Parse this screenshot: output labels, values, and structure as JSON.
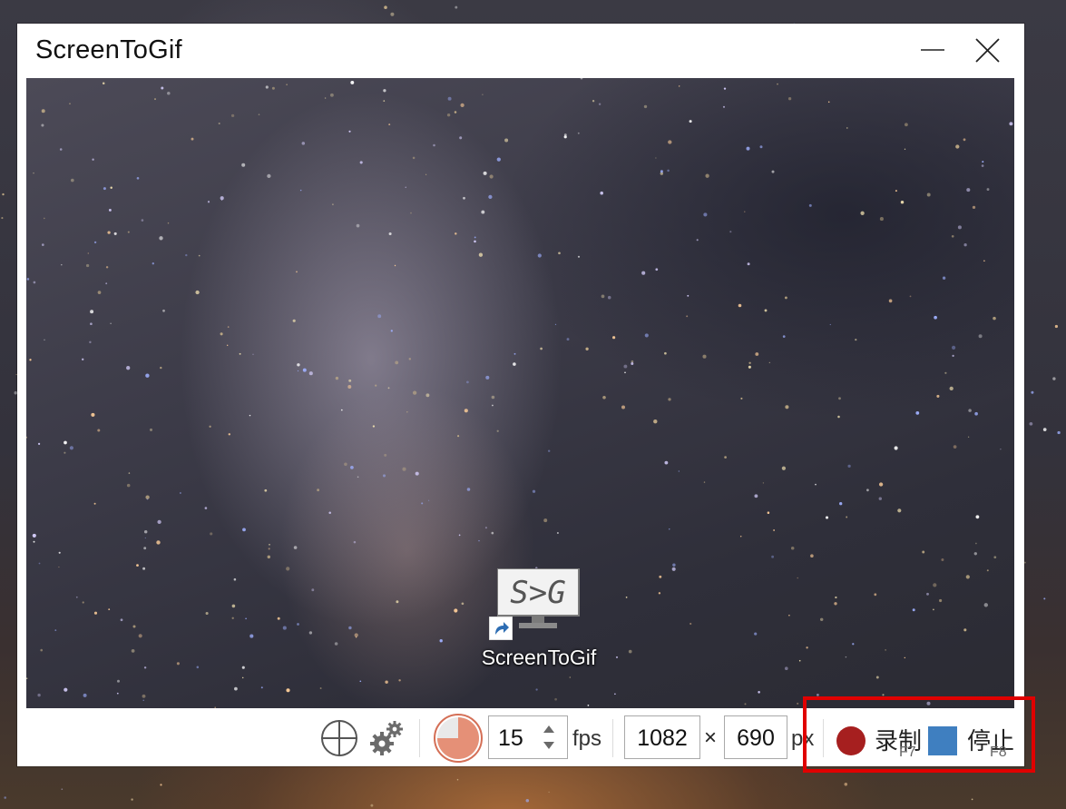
{
  "window": {
    "title": "ScreenToGif"
  },
  "desktop_icon": {
    "label": "ScreenToGif",
    "glyph_text": "S>G",
    "icon": "screentogif-monitor-icon"
  },
  "toolbar": {
    "fps_value": "15",
    "fps_unit": "fps",
    "width_value": "1082",
    "times_symbol": "×",
    "height_value": "690",
    "size_unit": "px",
    "record_label": "录制",
    "record_hotkey": "F7",
    "stop_label": "停止",
    "stop_hotkey": "F8"
  },
  "colors": {
    "record": "#a61f1f",
    "stop": "#3f7fc0",
    "highlight": "#e00000",
    "timer_fill": "#e59077"
  }
}
